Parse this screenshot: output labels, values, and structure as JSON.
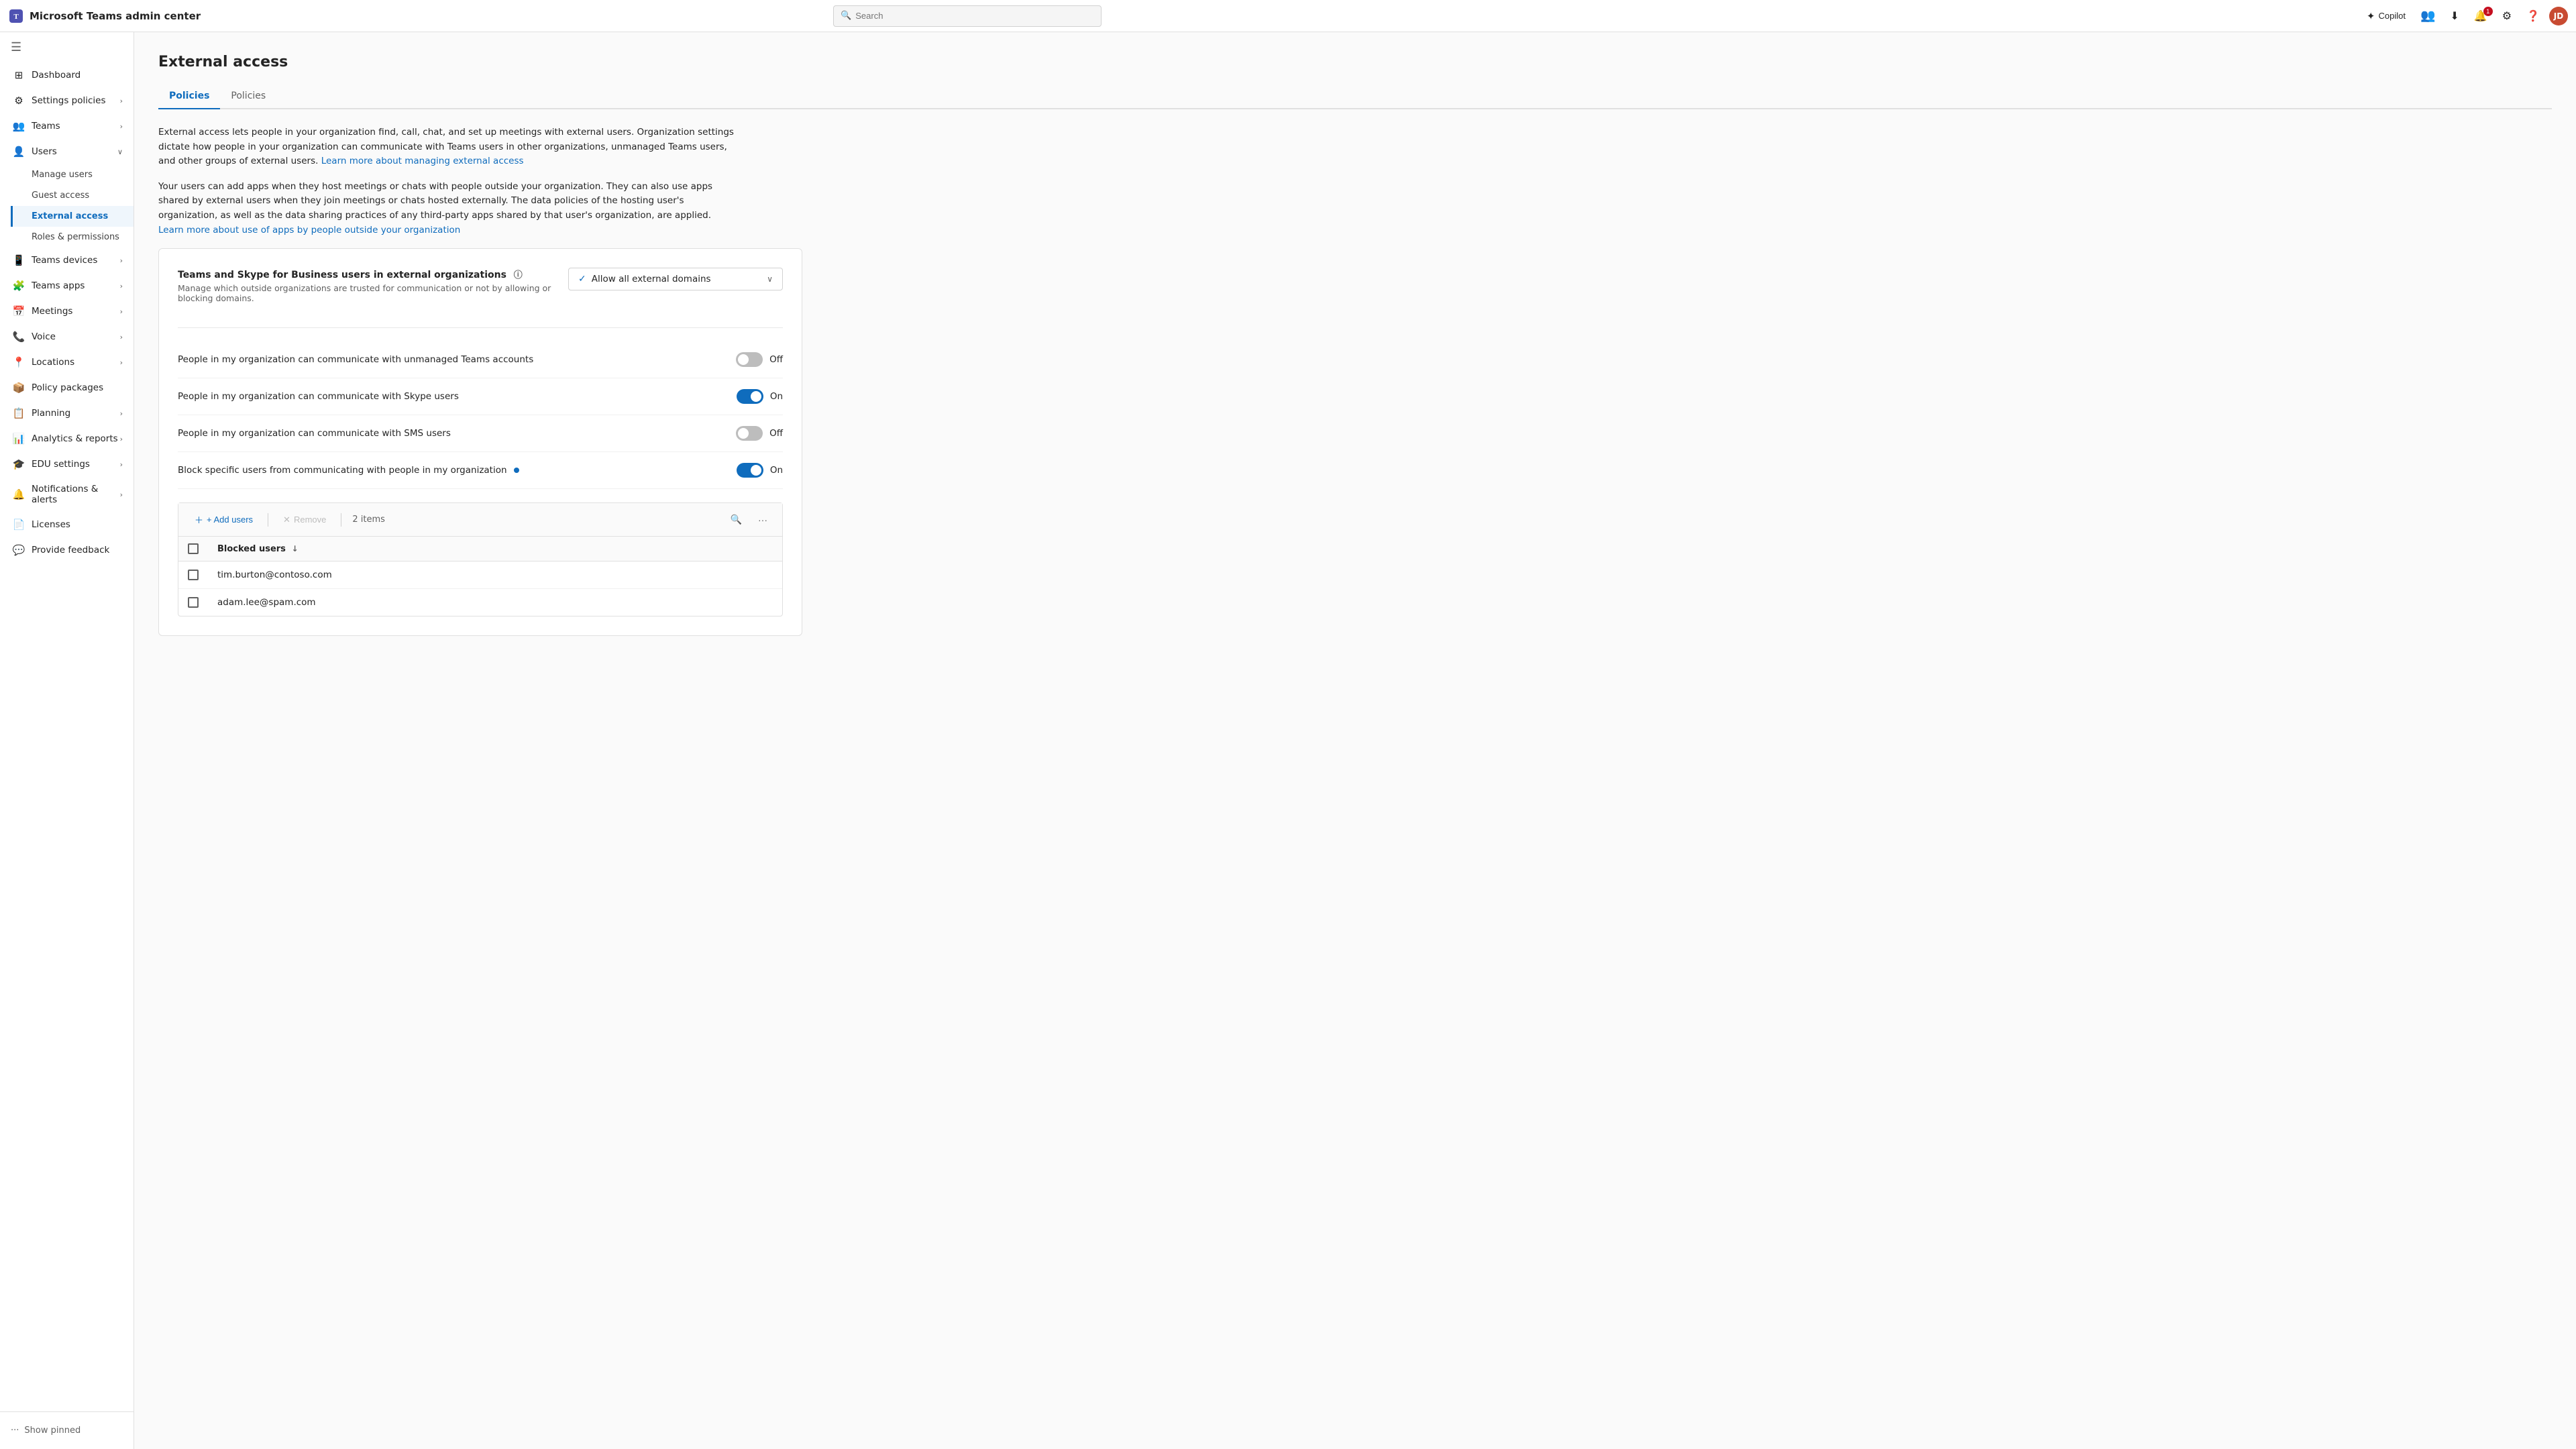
{
  "app": {
    "title": "Microsoft Teams admin center",
    "search_placeholder": "Search"
  },
  "topnav": {
    "copilot_label": "Copilot",
    "notification_count": "1",
    "avatar_initials": "JD"
  },
  "sidebar": {
    "toggle_icon": "☰",
    "items": [
      {
        "id": "dashboard",
        "label": "Dashboard",
        "icon": "⊞",
        "type": "item"
      },
      {
        "id": "settings-policies",
        "label": "Settings policies",
        "icon": "⚙",
        "type": "group",
        "expanded": false
      },
      {
        "id": "teams",
        "label": "Teams",
        "icon": "👥",
        "type": "group",
        "expanded": false
      },
      {
        "id": "users",
        "label": "Users",
        "icon": "👤",
        "type": "group",
        "expanded": true,
        "children": [
          {
            "id": "manage-users",
            "label": "Manage users"
          },
          {
            "id": "guest-access",
            "label": "Guest access"
          },
          {
            "id": "external-access",
            "label": "External access",
            "active": true
          },
          {
            "id": "roles-permissions",
            "label": "Roles & permissions"
          }
        ]
      },
      {
        "id": "teams-devices",
        "label": "Teams devices",
        "icon": "📱",
        "type": "group",
        "expanded": false
      },
      {
        "id": "teams-apps",
        "label": "Teams apps",
        "icon": "🧩",
        "type": "group",
        "expanded": false
      },
      {
        "id": "meetings",
        "label": "Meetings",
        "icon": "📅",
        "type": "group",
        "expanded": false
      },
      {
        "id": "voice",
        "label": "Voice",
        "icon": "📞",
        "type": "group",
        "expanded": false
      },
      {
        "id": "locations",
        "label": "Locations",
        "icon": "📍",
        "type": "group",
        "expanded": false
      },
      {
        "id": "policy-packages",
        "label": "Policy packages",
        "icon": "📦",
        "type": "item"
      },
      {
        "id": "planning",
        "label": "Planning",
        "icon": "📋",
        "type": "group",
        "expanded": false
      },
      {
        "id": "analytics-reports",
        "label": "Analytics & reports",
        "icon": "📊",
        "type": "group",
        "expanded": false
      },
      {
        "id": "edu-settings",
        "label": "EDU settings",
        "icon": "🎓",
        "type": "group",
        "expanded": false
      },
      {
        "id": "notifications-alerts",
        "label": "Notifications & alerts",
        "icon": "🔔",
        "type": "group",
        "expanded": false
      },
      {
        "id": "licenses",
        "label": "Licenses",
        "icon": "📄",
        "type": "item"
      },
      {
        "id": "provide-feedback",
        "label": "Provide feedback",
        "icon": "💬",
        "type": "item"
      }
    ],
    "show_pinned_label": "Show pinned",
    "show_pinned_icon": "···"
  },
  "page": {
    "title": "External access",
    "tabs": [
      {
        "id": "policies",
        "label": "Policies",
        "active": true
      },
      {
        "id": "policies2",
        "label": "Policies",
        "active": false
      }
    ],
    "description1": "External access lets people in your organization find, call, chat, and set up meetings with external users. Organization settings dictate how people in your organization can communicate with Teams users in other organizations, unmanaged Teams users, and other groups of external users.",
    "description1_link": "Learn more about managing external access",
    "description1_link_url": "#",
    "description2": "Your users can add apps when they host meetings or chats with people outside your organization. They can also use apps shared by external users when they join meetings or chats hosted externally. The data policies of the hosting user's organization, as well as the data sharing practices of any third-party apps shared by that user's organization, are applied.",
    "description2_link": "Learn more about use of apps by people outside your organization",
    "description2_link_url": "#"
  },
  "settings": {
    "section1": {
      "title": "Teams and Skype for Business users in external organizations",
      "subtitle": "Manage which outside organizations are trusted for communication or not by allowing or blocking domains.",
      "has_info": true,
      "dropdown_value": "Allow all external domains",
      "dropdown_icon": "✓"
    },
    "toggle_rows": [
      {
        "id": "unmanaged-teams",
        "label": "People in my organization can communicate with unmanaged Teams accounts",
        "state": "off",
        "state_label": "Off"
      },
      {
        "id": "skype-users",
        "label": "People in my organization can communicate with Skype users",
        "state": "on",
        "state_label": "On"
      },
      {
        "id": "sms-users",
        "label": "People in my organization can communicate with SMS users",
        "state": "off",
        "state_label": "Off"
      },
      {
        "id": "block-specific-users",
        "label": "Block specific users from communicating with people in my organization",
        "has_info_dot": true,
        "state": "on",
        "state_label": "On"
      }
    ],
    "blocked_users": {
      "add_btn": "+ Add users",
      "remove_btn": "Remove",
      "item_count": "2 items",
      "column_blocked_users": "Blocked users",
      "rows": [
        {
          "email": "tim.burton@contoso.com"
        },
        {
          "email": "adam.lee@spam.com"
        }
      ]
    }
  }
}
